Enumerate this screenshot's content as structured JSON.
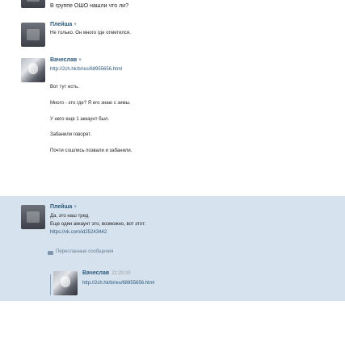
{
  "messages": [
    {
      "id": "m0",
      "text": "В группе ОШО нашли что ли?"
    },
    {
      "id": "m1",
      "author": "Плейша",
      "text": "Не только. Он много где отметился."
    },
    {
      "id": "m2",
      "author": "Вачеслав",
      "link": "http://2ch.hk/b/res/68955656.html",
      "lines": [
        "Вот тут есть.",
        "Много - это где? Я его знаю с зимы.",
        "У него еще 1 аккаунт был.",
        "Забанили говорят.",
        "Почти сошлись позвали и забанили."
      ]
    },
    {
      "id": "m3",
      "author": "Плейша",
      "lines": [
        "Да, это наш тред.",
        "Еще один аккаунт это, возможно, вот этот:"
      ],
      "link": "https://vk.com/id25243442"
    }
  ],
  "forwarded": {
    "label": "Пересланные сообщения",
    "author": "Вачеслав",
    "time": "21:20:20",
    "link": "http://2ch.hk/b/res/68955656.html"
  }
}
